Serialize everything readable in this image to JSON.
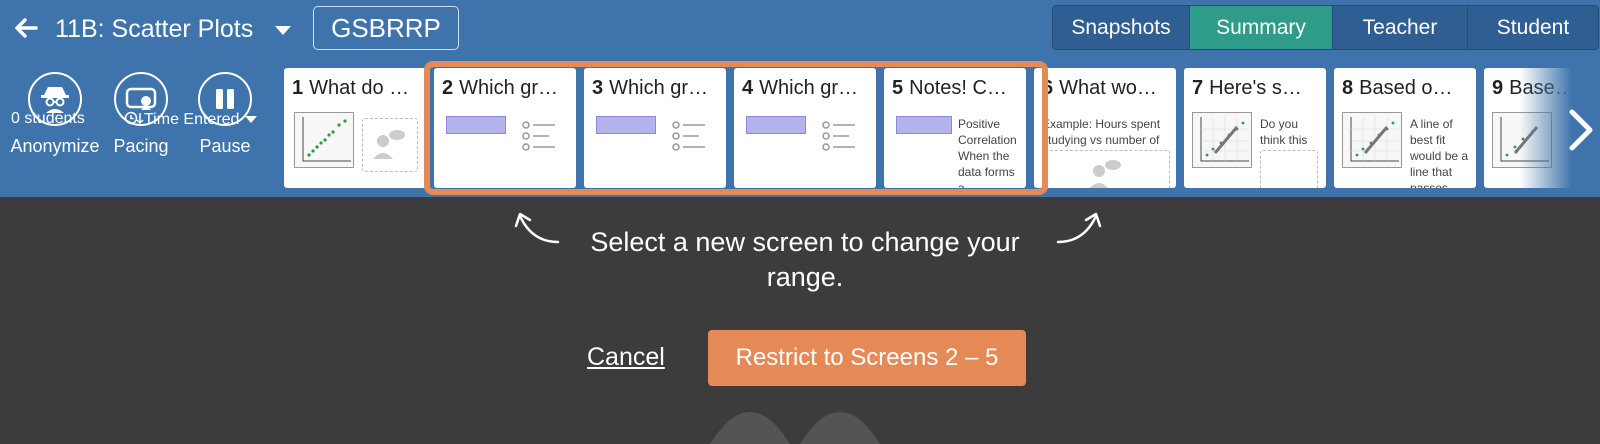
{
  "header": {
    "activity_title": "11B: Scatter Plots",
    "class_code": "GSBRRP",
    "tabs": [
      {
        "label": "Snapshots",
        "active": false
      },
      {
        "label": "Summary",
        "active": true
      },
      {
        "label": "Teacher",
        "active": false
      },
      {
        "label": "Student",
        "active": false
      }
    ]
  },
  "controls": {
    "anonymize_label": "Anonymize",
    "pacing_label": "Pacing",
    "pause_label": "Pause",
    "students_count": "0 students",
    "sort_label": "Time Entered"
  },
  "screens": [
    {
      "number": "1",
      "title": "What do …"
    },
    {
      "number": "2",
      "title": "Which gr…"
    },
    {
      "number": "3",
      "title": "Which gr…"
    },
    {
      "number": "4",
      "title": "Which gr…"
    },
    {
      "number": "5",
      "title": "Notes! C…",
      "preview_text": "Positive Correlation When the data forms a"
    },
    {
      "number": "6",
      "title": "What wo…",
      "preview_text": "Example: Hours spent studying vs number of"
    },
    {
      "number": "7",
      "title": "Here's s…",
      "preview_text": "Do you think this"
    },
    {
      "number": "8",
      "title": "Based o…",
      "preview_text": "A line of best fit would be a line that passes"
    },
    {
      "number": "9",
      "title": "Base…"
    }
  ],
  "overlay": {
    "instruction": "Select a new screen to change your range.",
    "cancel_label": "Cancel",
    "restrict_label": "Restrict to Screens 2 – 5"
  },
  "colors": {
    "header_blue": "#3e74ab",
    "active_tab": "#2f9c8a",
    "accent_orange": "#e58a56",
    "overlay_bg": "#3c3c3c"
  }
}
